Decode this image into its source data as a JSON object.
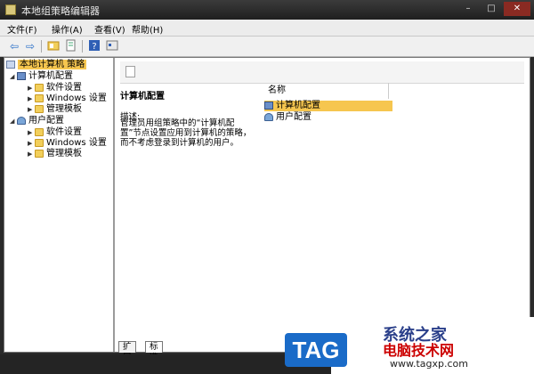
{
  "window": {
    "title": "本地组策略编辑器",
    "controls": {
      "minimize": "–",
      "maximize": "□",
      "close": "✕"
    }
  },
  "menu": [
    "文件(F)",
    "操作(A)",
    "查看(V)",
    "帮助(H)"
  ],
  "toolbar": {
    "icons": [
      "back-icon",
      "forward-icon",
      "show-tree-icon",
      "export-icon",
      "help-icon",
      "properties-icon"
    ]
  },
  "tree": {
    "root": "本地计算机 策略",
    "computer": {
      "label": "计算机配置",
      "children": [
        "软件设置",
        "Windows 设置",
        "管理模板"
      ]
    },
    "user": {
      "label": "用户配置",
      "children": [
        "软件设置",
        "Windows 设置",
        "管理模板"
      ]
    }
  },
  "detail": {
    "title": "计算机配置",
    "desc_label": "描述:",
    "desc_text": "管理员用组策略中的“计算机配置”节点设置应用到计算机的策略，而不考虑登录到计算机的用户。"
  },
  "list": {
    "column": "名称",
    "items": [
      "计算机配置",
      "用户配置"
    ]
  },
  "tabs": [
    "扩展",
    "标准"
  ],
  "watermark": {
    "tag": "TAG",
    "site": "系统之家",
    "name": "电脑技术网",
    "url": "www.tagxp.com"
  },
  "colors": {
    "selection": "#f6c64f"
  }
}
